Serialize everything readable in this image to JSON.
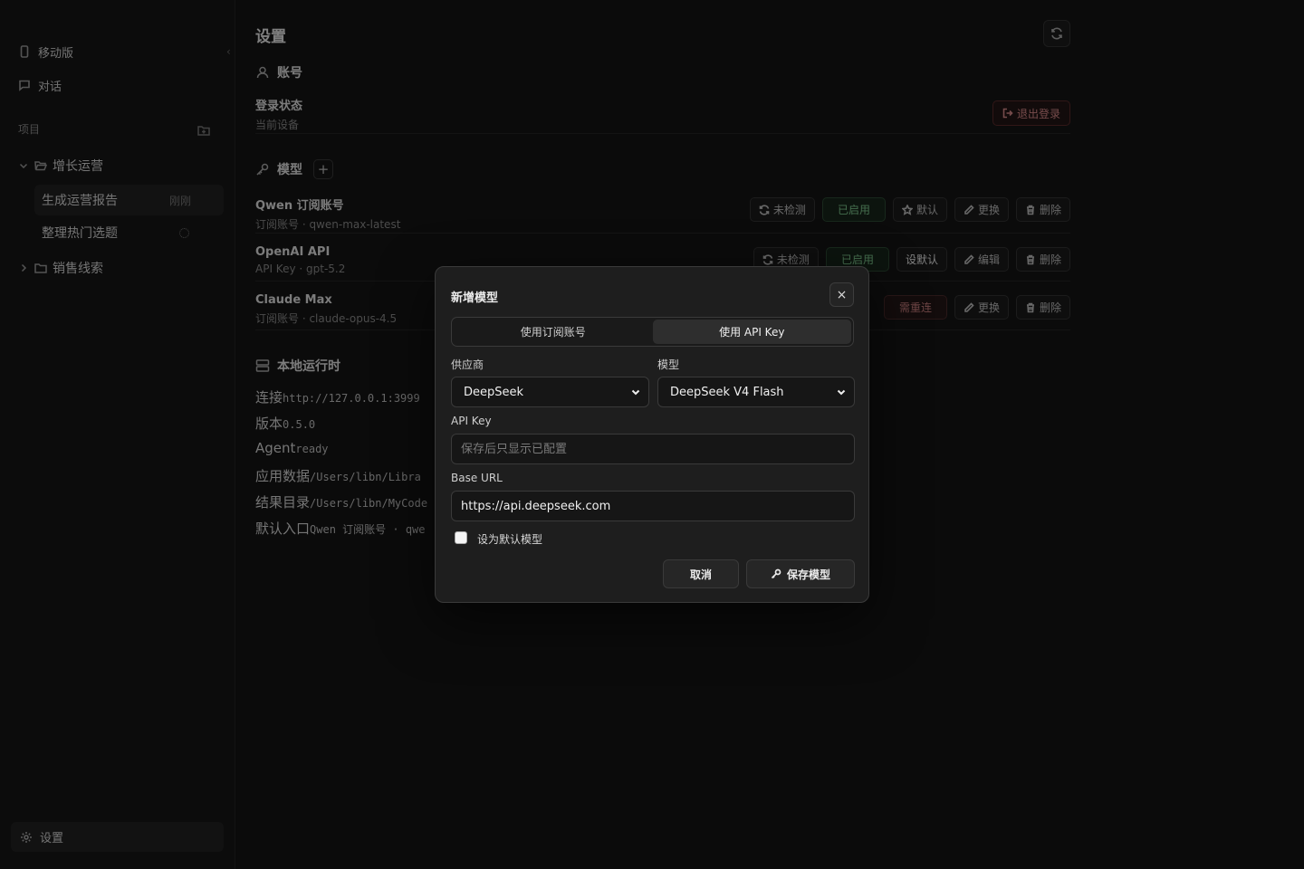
{
  "sidebar": {
    "mobile_label": "移动版",
    "chat_label": "对话",
    "projects_label": "项目",
    "projects": [
      {
        "name": "增长运营",
        "expanded": true,
        "tasks": [
          {
            "name": "生成运营报告",
            "meta": "刚刚",
            "active": true
          },
          {
            "name": "整理热门选题",
            "meta": "",
            "loading": true
          }
        ]
      },
      {
        "name": "销售线索",
        "expanded": false,
        "tasks": []
      }
    ],
    "settings_label": "设置"
  },
  "main": {
    "title": "设置",
    "account": {
      "heading": "账号",
      "login_title": "登录状态",
      "login_sub": "当前设备",
      "logout_label": "退出登录"
    },
    "models": {
      "heading": "模型",
      "add_label": "+",
      "rows": [
        {
          "name": "Qwen 订阅账号",
          "sub": "订阅账号 · qwen-max-latest",
          "check": "未检测",
          "status": "已启用",
          "default": "默认",
          "action": "更换",
          "delete": "删除"
        },
        {
          "name": "OpenAI API",
          "sub": "API Key · gpt-5.2",
          "check": "未检测",
          "status": "已启用",
          "default": "设默认",
          "action": "编辑",
          "delete": "删除"
        },
        {
          "name": "Claude Max",
          "sub": "订阅账号 · claude-opus-4.5",
          "status": "需重连",
          "action": "更换",
          "delete": "删除"
        }
      ]
    },
    "runtime": {
      "heading": "本地运行时",
      "lines": [
        {
          "label": "连接",
          "value": "http://127.0.0.1:3999"
        },
        {
          "label": "版本",
          "value": "0.5.0"
        },
        {
          "label": "Agent",
          "value": "ready"
        },
        {
          "label": "应用数据",
          "value": "/Users/libn/Libra"
        },
        {
          "label": "结果目录",
          "value": "/Users/libn/MyCode"
        },
        {
          "label": "默认入口",
          "value": "Qwen 订阅账号 · qwe"
        }
      ]
    }
  },
  "modal": {
    "title": "新增模型",
    "close_label": "×",
    "tabs": [
      {
        "label": "使用订阅账号",
        "active": false
      },
      {
        "label": "使用 API Key",
        "active": true
      }
    ],
    "provider_label": "供应商",
    "provider_value": "DeepSeek",
    "model_label": "模型",
    "model_value": "DeepSeek V4 Flash",
    "api_key_label": "API Key",
    "api_key_placeholder": "保存后只显示已配置",
    "base_url_label": "Base URL",
    "base_url_value": "https://api.deepseek.com",
    "default_checkbox_label": "设为默认模型",
    "default_checked": false,
    "cancel_label": "取消",
    "save_label": "保存模型"
  }
}
